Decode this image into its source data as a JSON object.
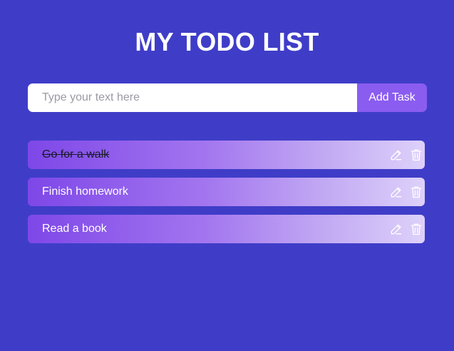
{
  "header": {
    "title": "MY TODO LIST"
  },
  "form": {
    "placeholder": "Type your text here",
    "value": "",
    "add_label": "Add Task"
  },
  "todos": [
    {
      "text": "Go for a walk",
      "completed": true
    },
    {
      "text": "Finish homework",
      "completed": false
    },
    {
      "text": "Read a book",
      "completed": false
    }
  ],
  "icons": {
    "edit": "edit-icon",
    "delete": "trash-icon"
  },
  "colors": {
    "background": "#3f3dc8",
    "button": "#8b5cf0",
    "item_gradient_start": "#7e47e8",
    "item_gradient_end": "#ddd1fa"
  }
}
